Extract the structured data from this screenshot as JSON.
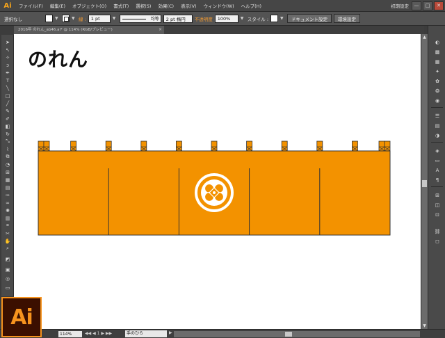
{
  "app": {
    "logo": "Ai",
    "workspace": "初期設定"
  },
  "menu": [
    "ファイル(F)",
    "編集(E)",
    "オブジェクト(O)",
    "書式(T)",
    "選択(S)",
    "効果(C)",
    "表示(V)",
    "ウィンドウ(W)",
    "ヘルプ(H)"
  ],
  "window_buttons": {
    "minimize": "—",
    "maximize": "□",
    "close": "✕"
  },
  "control": {
    "selection": "選択なし",
    "stroke_label": "線 :",
    "stroke_weight": "1 pt",
    "profile": "均等",
    "brush": "2 pt 楕円",
    "opacity_label": "不透明度",
    "opacity_value": "100%",
    "style_label": "スタイル :",
    "doc_settings": "ドキュメント設定",
    "prefs": "環境設定"
  },
  "document_tab": {
    "name": "2016年 のれん_ab46.ai* @ 114% (RGB/プレビュー)",
    "close": "×"
  },
  "canvas": {
    "title": "のれん"
  },
  "noren": {
    "fill": "#f39200",
    "outline": "#333333",
    "emblem_color": "#ffffff",
    "panels": 5,
    "loops": 10
  },
  "status": {
    "zoom": "114%",
    "page": "1",
    "tool": "手のひら"
  },
  "ai_badge": "Ai"
}
